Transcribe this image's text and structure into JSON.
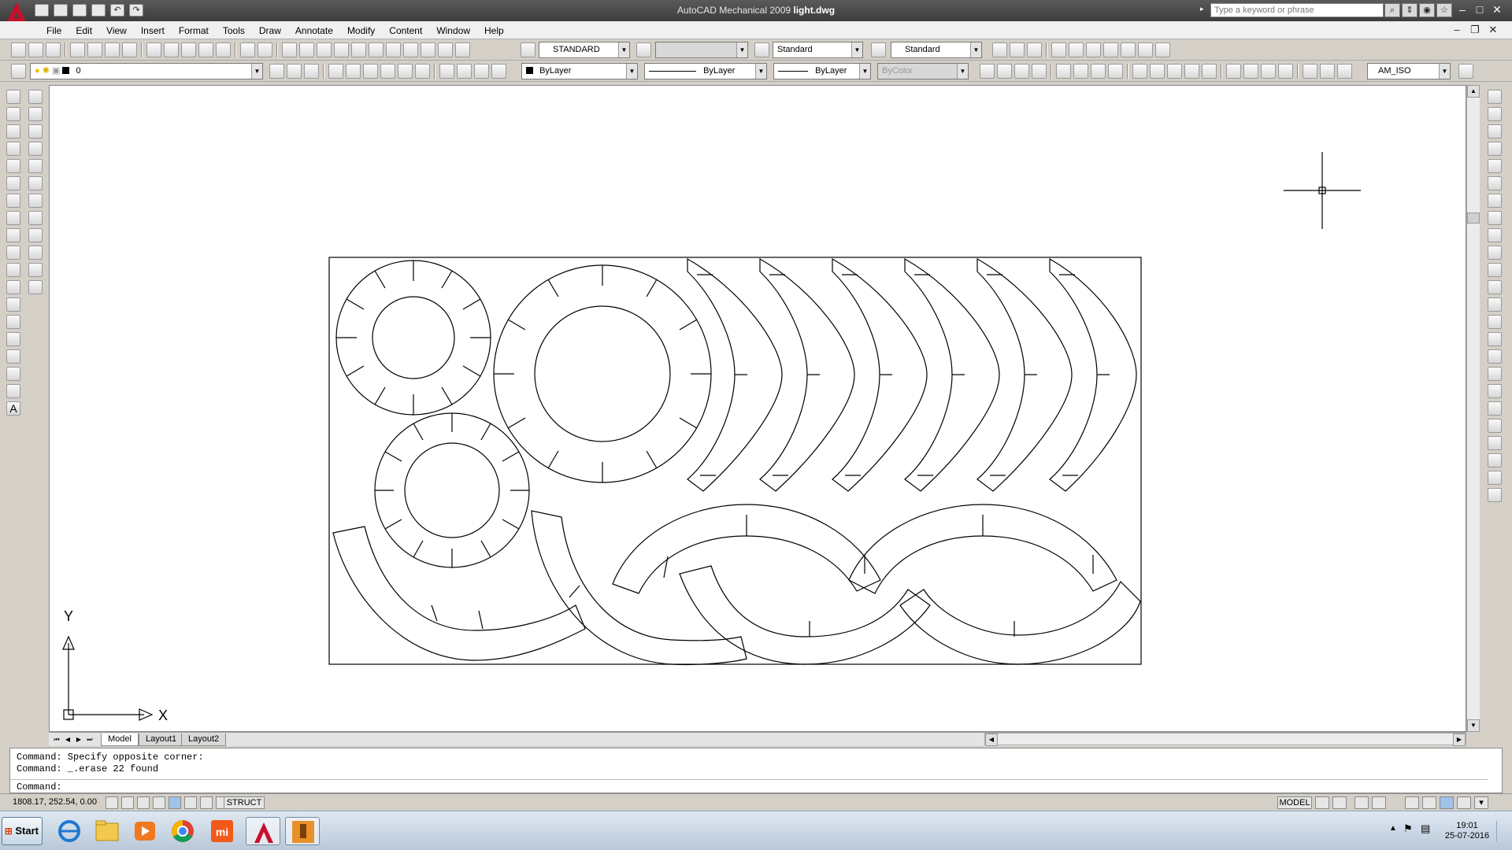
{
  "window": {
    "app_name": "AutoCAD Mechanical 2009",
    "file_name": "light.dwg",
    "search_placeholder": "Type a keyword or phrase"
  },
  "menu": [
    "File",
    "Edit",
    "View",
    "Insert",
    "Format",
    "Tools",
    "Draw",
    "Annotate",
    "Modify",
    "Content",
    "Window",
    "Help"
  ],
  "toolbar": {
    "text_style": "STANDARD",
    "dim_style": "",
    "table_style": "Standard",
    "multileader_style": "Standard",
    "layer": "0",
    "color": "ByLayer",
    "linetype": "ByLayer",
    "lineweight": "ByLayer",
    "plot_style": "ByColor",
    "dim_standard": "AM_ISO"
  },
  "ucs": {
    "y_label": "Y",
    "x_label": "X"
  },
  "tabs": {
    "model": "Model",
    "layout1": "Layout1",
    "layout2": "Layout2"
  },
  "command": {
    "history": [
      "Command: Specify opposite corner:",
      "Command: _.erase 22 found"
    ],
    "prompt": "Command:"
  },
  "status": {
    "coordinates": "1808.17, 252.54, 0.00",
    "struct": "STRUCT",
    "model": "MODEL"
  },
  "taskbar": {
    "start": "Start",
    "time": "19:01",
    "date": "25-07-2016",
    "apps": [
      "internet-explorer",
      "file-explorer",
      "media-player",
      "chrome",
      "mi",
      "autocad-mechanical",
      "inventor-pro"
    ]
  },
  "colors": {
    "titlebar": "#3c3c3c",
    "canvas": "#ffffff",
    "autocad_red": "#c8102e"
  }
}
